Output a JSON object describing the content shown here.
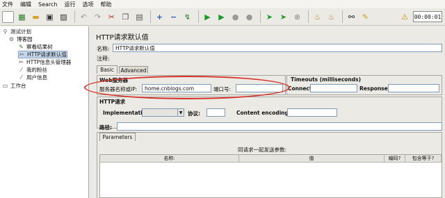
{
  "menu": [
    "文件",
    "编辑",
    "Search",
    "运行",
    "选项",
    "帮助"
  ],
  "toolbar": {
    "icons": [
      "new-icon",
      "template-icon",
      "open-icon",
      "save-icon",
      "save-as-icon",
      "undo-icon",
      "redo-icon",
      "cut-icon",
      "copy-icon",
      "paste-icon",
      "expand-icon",
      "collapse-icon",
      "toggle-icon",
      "start-icon",
      "start-no-pause-icon",
      "stop-icon",
      "shutdown-icon",
      "remote-start-icon",
      "remote-stop-icon",
      "remote-exit-icon",
      "clear-icon",
      "clear-all-icon",
      "search-icon",
      "reset-search-icon"
    ],
    "warning_icon": "warning-icon",
    "timer": "00:00:01"
  },
  "tree": {
    "items": [
      {
        "label": "测试计划",
        "icon": "test-plan-icon"
      },
      {
        "label": "博客园",
        "icon": "thread-group-icon"
      },
      {
        "label": "察看结果树",
        "icon": "results-tree-icon"
      },
      {
        "label": "HTTP请求默认值",
        "icon": "config-icon"
      },
      {
        "label": "HTTP信息头管理器",
        "icon": "header-manager-icon"
      },
      {
        "label": "我的粉丝",
        "icon": "sampler-icon"
      },
      {
        "label": "用户信息",
        "icon": "sampler-icon"
      },
      {
        "label": "工作台",
        "icon": "workbench-icon"
      }
    ]
  },
  "panel": {
    "title": "HTTP请求默认值",
    "name_label": "名称:",
    "name_value": "HTTP请求默认值",
    "comment_label": "注释:",
    "tabs": [
      "Basic",
      "Advanced"
    ],
    "web_server": {
      "title": "Web服务器",
      "server_label": "服务器名称或IP:",
      "server_value": "home.cnblogs.com",
      "port_label": "端口号:",
      "port_value": ""
    },
    "timeouts": {
      "title": "Timeouts (milliseconds)",
      "connect_label": "Connect:",
      "response_label": "Response:"
    },
    "http_request": {
      "title": "HTTP请求",
      "impl_label": "Implementation:",
      "protocol_label": "协议:",
      "encoding_label": "Content encoding:",
      "path_label": "路径:"
    },
    "params": {
      "tab": "Parameters",
      "caption": "同请求一起发送参数:",
      "columns": [
        "名称:",
        "值",
        "编码?",
        "包含等于?"
      ]
    }
  },
  "colors": {
    "highlight": "#d6332a",
    "selection": "#c5d7ec"
  }
}
